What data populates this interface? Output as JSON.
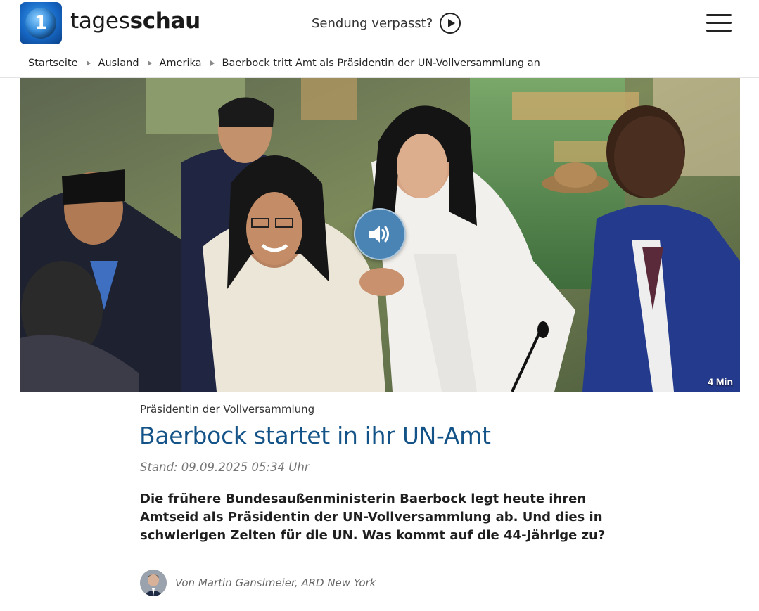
{
  "header": {
    "brand_light": "tages",
    "brand_bold": "schau",
    "missed_label": "Sendung verpasst?"
  },
  "breadcrumb": [
    {
      "label": "Startseite"
    },
    {
      "label": "Ausland"
    },
    {
      "label": "Amerika"
    },
    {
      "label": "Baerbock tritt Amt als Präsidentin der UN-Vollversammlung an"
    }
  ],
  "hero": {
    "duration": "4 Min"
  },
  "article": {
    "topline": "Präsidentin der Vollversammlung",
    "headline": "Baerbock startet in ihr UN-Amt",
    "stand": "Stand: 09.09.2025 05:34 Uhr",
    "teaser": "Die frühere Bundesaußenministerin Baerbock legt heute ihren Amtseid als Präsidentin der UN-Vollversammlung ab. Und dies in schwierigen Zeiten für die UN. Was kommt auf die 44-Jährige zu?",
    "author": "Von Martin Ganslmeier, ARD New York"
  },
  "colors": {
    "headline": "#145387",
    "audio_button": "#4a84b4"
  },
  "icons": {
    "logo": "tagesschau-logo-icon",
    "play": "play-circle-icon",
    "menu": "hamburger-menu-icon",
    "audio": "speaker-icon",
    "breadcrumb_separator": "triangle-right-icon"
  }
}
